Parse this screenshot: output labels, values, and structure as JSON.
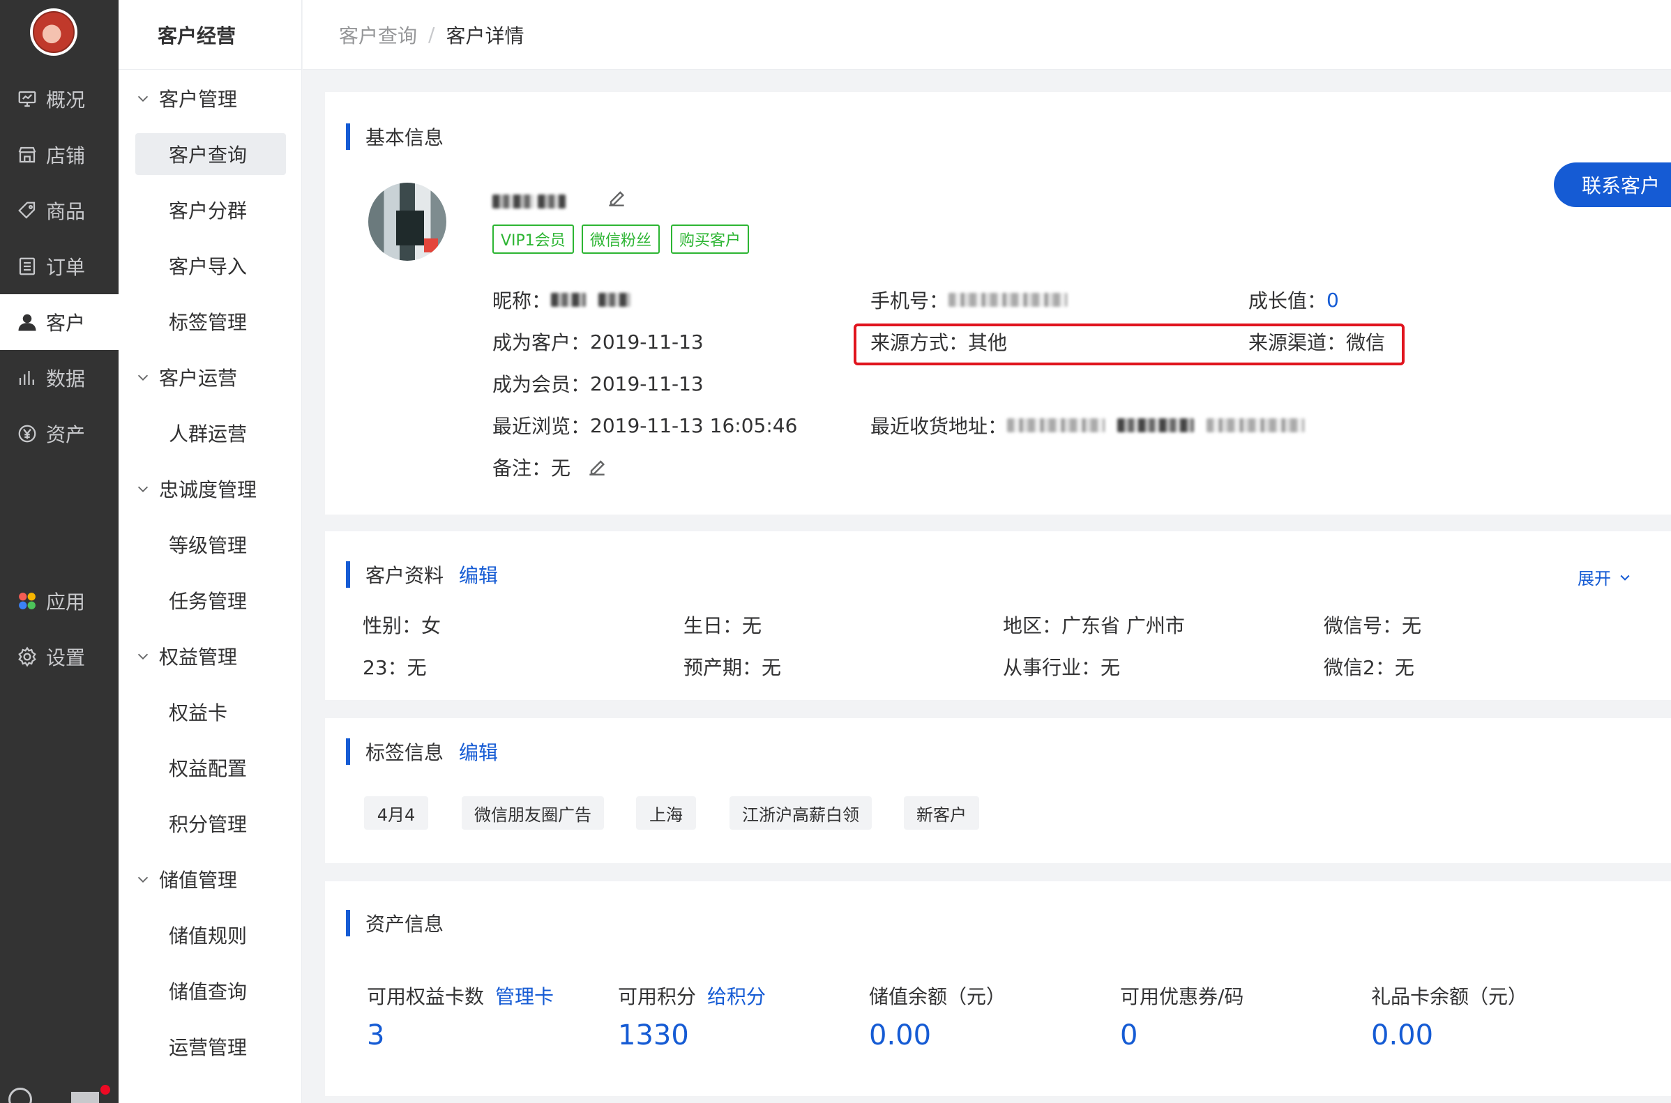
{
  "nav": {
    "items": [
      {
        "label": "概况",
        "icon": "monitor-icon"
      },
      {
        "label": "店铺",
        "icon": "store-icon"
      },
      {
        "label": "商品",
        "icon": "tag-icon"
      },
      {
        "label": "订单",
        "icon": "list-icon"
      },
      {
        "label": "客户",
        "icon": "user-icon"
      },
      {
        "label": "数据",
        "icon": "bar-chart-icon"
      },
      {
        "label": "资产",
        "icon": "yen-icon"
      },
      {
        "label": "应用",
        "icon": "apps-icon"
      },
      {
        "label": "设置",
        "icon": "gear-icon"
      }
    ]
  },
  "sub": {
    "title": "客户经营",
    "groups": [
      {
        "label": "客户管理",
        "items": [
          "客户查询",
          "客户分群",
          "客户导入",
          "标签管理"
        ]
      },
      {
        "label": "客户运营",
        "items": [
          "人群运营"
        ]
      },
      {
        "label": "忠诚度管理",
        "items": [
          "等级管理",
          "任务管理"
        ]
      },
      {
        "label": "权益管理",
        "items": [
          "权益卡",
          "权益配置",
          "积分管理"
        ]
      },
      {
        "label": "储值管理",
        "items": [
          "储值规则",
          "储值查询",
          "运营管理"
        ]
      }
    ]
  },
  "header": {
    "crumb1": "客户查询",
    "sep": "/",
    "crumb2": "客户详情"
  },
  "basic": {
    "title": "基本信息",
    "tags": [
      "VIP1会员",
      "微信粉丝",
      "购买客户"
    ],
    "contact_button": "联系客户",
    "nickname_label": "昵称：",
    "phone_label": "手机号：",
    "growth_label": "成长值：",
    "growth_value": "0",
    "customer_since_label": "成为客户：",
    "customer_since": "2019-11-13",
    "source_method_label": "来源方式：",
    "source_method": "其他",
    "source_channel_label": "来源渠道：",
    "source_channel": "微信",
    "member_since_label": "成为会员：",
    "member_since": "2019-11-13",
    "last_visit_label": "最近浏览：",
    "last_visit": "2019-11-13 16:05:46",
    "address_label": "最近收货地址：",
    "remark_label": "备注：",
    "remark": "无"
  },
  "profile": {
    "title": "客户资料",
    "edit": "编辑",
    "expand": "展开",
    "fields": [
      {
        "label": "性别：",
        "value": "女"
      },
      {
        "label": "生日：",
        "value": "无"
      },
      {
        "label": "地区：",
        "value": "广东省 广州市"
      },
      {
        "label": "微信号：",
        "value": "无"
      },
      {
        "label": "23：",
        "value": "无"
      },
      {
        "label": "预产期：",
        "value": "无"
      },
      {
        "label": "从事行业：",
        "value": "无"
      },
      {
        "label": "微信2：",
        "value": "无"
      }
    ]
  },
  "tags": {
    "title": "标签信息",
    "edit": "编辑",
    "chips": [
      "4月4",
      "微信朋友圈广告",
      "上海",
      "江浙沪高薪白领",
      "新客户"
    ]
  },
  "assets": {
    "title": "资产信息",
    "items": [
      {
        "label": "可用权益卡数",
        "link": "管理卡",
        "value": "3"
      },
      {
        "label": "可用积分",
        "link": "给积分",
        "value": "1330"
      },
      {
        "label": "储值余额（元）",
        "link": "",
        "value": "0.00"
      },
      {
        "label": "可用优惠券/码",
        "link": "",
        "value": "0"
      },
      {
        "label": "礼品卡余额（元）",
        "link": "",
        "value": "0.00"
      }
    ]
  },
  "colors": {
    "accent": "#155bd4",
    "green": "#2db533",
    "highlight": "#e0141e",
    "nav_bg": "#333333"
  }
}
